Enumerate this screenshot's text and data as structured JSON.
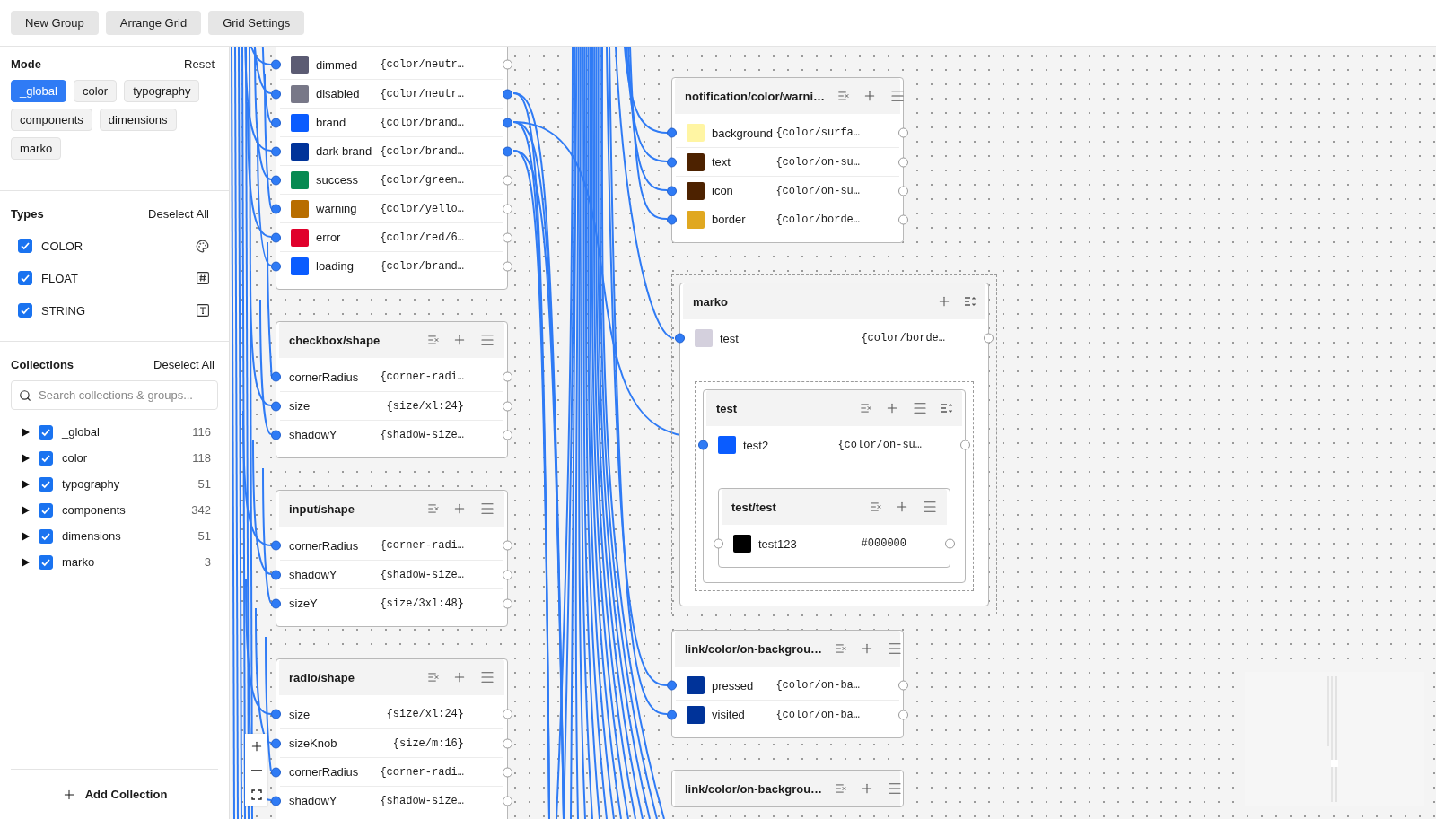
{
  "toolbar": {
    "buttons": [
      "New Group",
      "Arrange Grid",
      "Grid Settings"
    ]
  },
  "sidebar": {
    "mode": {
      "title": "Mode",
      "action": "Reset",
      "chips": [
        {
          "label": "_global",
          "selected": true
        },
        {
          "label": "color",
          "selected": false
        },
        {
          "label": "typography",
          "selected": false
        },
        {
          "label": "components",
          "selected": false
        },
        {
          "label": "dimensions",
          "selected": false
        },
        {
          "label": "marko",
          "selected": false
        }
      ]
    },
    "types": {
      "title": "Types",
      "action": "Deselect All",
      "items": [
        {
          "label": "COLOR",
          "checked": true,
          "kind": "color"
        },
        {
          "label": "FLOAT",
          "checked": true,
          "kind": "float"
        },
        {
          "label": "STRING",
          "checked": true,
          "kind": "string"
        }
      ]
    },
    "collections": {
      "title": "Collections",
      "action": "Deselect All",
      "search": {
        "placeholder": "Search collections & groups..."
      },
      "items": [
        {
          "label": "_global",
          "count": "116",
          "checked": true,
          "expanded": false
        },
        {
          "label": "color",
          "count": "118",
          "checked": true,
          "expanded": false
        },
        {
          "label": "typography",
          "count": "51",
          "checked": true,
          "expanded": false
        },
        {
          "label": "components",
          "count": "342",
          "checked": true,
          "expanded": false
        },
        {
          "label": "dimensions",
          "count": "51",
          "checked": true,
          "expanded": false
        },
        {
          "label": "marko",
          "count": "3",
          "checked": true,
          "expanded": false
        }
      ]
    },
    "add_button": "Add Collection"
  },
  "canvas": {
    "nodes": [
      {
        "rows": [
          {
            "name": "dimmed",
            "value": "{color/neutr…",
            "color": "#5b5b73",
            "input_connected": true,
            "output_connected": false
          },
          {
            "name": "disabled",
            "value": "{color/neutr…",
            "color": "#787888",
            "input_connected": true,
            "output_connected": true
          },
          {
            "name": "brand",
            "value": "{color/brand…",
            "color": "#0a5cff",
            "input_connected": true,
            "output_connected": true
          },
          {
            "name": "dark brand",
            "value": "{color/brand…",
            "color": "#003399",
            "input_connected": true,
            "output_connected": true
          },
          {
            "name": "success",
            "value": "{color/green…",
            "color": "#078a52",
            "input_connected": true,
            "output_connected": false
          },
          {
            "name": "warning",
            "value": "{color/yello…",
            "color": "#b86e00",
            "input_connected": true,
            "output_connected": false
          },
          {
            "name": "error",
            "value": "{color/red/6…",
            "color": "#e0002b",
            "input_connected": true,
            "output_connected": false
          },
          {
            "name": "loading",
            "value": "{color/brand…",
            "color": "#0a5cff",
            "input_connected": true,
            "output_connected": false
          }
        ]
      },
      {
        "title": "checkbox/shape",
        "actions": [
          {
            "kind": "clear"
          },
          {
            "kind": "add"
          },
          {
            "kind": "menu"
          }
        ],
        "rows": [
          {
            "name": "cornerRadius",
            "value": "{corner-radi…",
            "input_connected": true,
            "output_connected": false
          },
          {
            "name": "size",
            "value": "{size/xl:24}",
            "input_connected": true,
            "output_connected": false
          },
          {
            "name": "shadowY",
            "value": "{shadow-size…",
            "input_connected": true,
            "output_connected": false
          }
        ]
      },
      {
        "title": "input/shape",
        "actions": [
          {
            "kind": "clear"
          },
          {
            "kind": "add"
          },
          {
            "kind": "menu"
          }
        ],
        "rows": [
          {
            "name": "cornerRadius",
            "value": "{corner-radi…",
            "input_connected": true,
            "output_connected": false
          },
          {
            "name": "shadowY",
            "value": "{shadow-size…",
            "input_connected": true,
            "output_connected": false
          },
          {
            "name": "sizeY",
            "value": "{size/3xl:48}",
            "input_connected": true,
            "output_connected": false
          }
        ]
      },
      {
        "title": "radio/shape",
        "actions": [
          {
            "kind": "clear"
          },
          {
            "kind": "add"
          },
          {
            "kind": "menu"
          }
        ],
        "rows": [
          {
            "name": "size",
            "value": "{size/xl:24}",
            "input_connected": true,
            "output_connected": false
          },
          {
            "name": "sizeKnob",
            "value": "{size/m:16}",
            "input_connected": true,
            "output_connected": false
          },
          {
            "name": "cornerRadius",
            "value": "{corner-radi…",
            "input_connected": true,
            "output_connected": false
          },
          {
            "name": "shadowY",
            "value": "{shadow-size…",
            "input_connected": true,
            "output_connected": false
          }
        ]
      },
      {
        "title": "notification/color/warni…",
        "actions": [
          {
            "kind": "clear"
          },
          {
            "kind": "add"
          },
          {
            "kind": "menu"
          }
        ],
        "rows": [
          {
            "name": "background",
            "value": "{color/surfa…",
            "color": "#fff5a3",
            "input_connected": true,
            "output_connected": false
          },
          {
            "name": "text",
            "value": "{color/on-su…",
            "color": "#4d2200",
            "input_connected": true,
            "output_connected": false
          },
          {
            "name": "icon",
            "value": "{color/on-su…",
            "color": "#4d2200",
            "input_connected": true,
            "output_connected": false
          },
          {
            "name": "border",
            "value": "{color/borde…",
            "color": "#e0a820",
            "input_connected": true,
            "output_connected": false
          }
        ]
      },
      {
        "title": "marko",
        "actions": [
          {
            "kind": "add"
          },
          {
            "kind": "sort"
          }
        ],
        "rows": [
          {
            "name": "test",
            "value": "{color/borde…",
            "color": "#d4d0dd",
            "input_connected": true,
            "output_connected": false
          }
        ],
        "children": [
          {
            "title": "test",
            "actions": [
              {
                "kind": "clear"
              },
              {
                "kind": "add"
              },
              {
                "kind": "menu"
              },
              {
                "kind": "sort"
              }
            ],
            "rows": [
              {
                "name": "test2",
                "value": "{color/on-su…",
                "color": "#0a5cff",
                "input_connected": true,
                "output_connected": false
              }
            ],
            "children": [
              {
                "title": "test/test",
                "actions": [
                  {
                    "kind": "clear"
                  },
                  {
                    "kind": "add"
                  },
                  {
                    "kind": "menu"
                  }
                ],
                "rows": [
                  {
                    "name": "test123",
                    "value": "#000000",
                    "color": "#000000",
                    "input_connected": false,
                    "output_connected": false
                  }
                ]
              }
            ]
          }
        ]
      },
      {
        "title": "link/color/on-backgrou…",
        "actions": [
          {
            "kind": "clear"
          },
          {
            "kind": "add"
          },
          {
            "kind": "menu"
          }
        ],
        "rows": [
          {
            "name": "pressed",
            "value": "{color/on-ba…",
            "color": "#003399",
            "input_connected": true,
            "output_connected": false
          },
          {
            "name": "visited",
            "value": "{color/on-ba…",
            "color": "#003399",
            "input_connected": true,
            "output_connected": false
          }
        ]
      },
      {
        "title": "link/color/on-backgrou…",
        "actions": [
          {
            "kind": "clear"
          },
          {
            "kind": "add"
          },
          {
            "kind": "menu"
          }
        ]
      }
    ]
  }
}
